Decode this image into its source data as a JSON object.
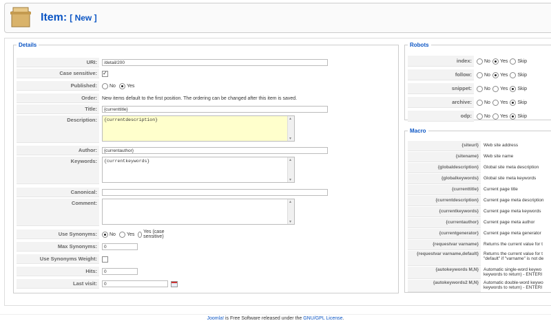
{
  "header": {
    "title": "Item:",
    "subtitle": "[ New ]"
  },
  "details": {
    "legend": "Details",
    "url": {
      "label": "URI:",
      "value": "/detail/200"
    },
    "case_sensitive": {
      "label": "Case sensitive:",
      "checked": true
    },
    "published": {
      "label": "Published:",
      "no": "No",
      "yes": "Yes",
      "selected": "Yes"
    },
    "order": {
      "label": "Order:",
      "text": "New items default to the first position. The ordering can be changed after this item is saved."
    },
    "title": {
      "label": "Title:",
      "value": "{currenttitle}"
    },
    "description": {
      "label": "Description:",
      "value": "{currentdescription}"
    },
    "author": {
      "label": "Author:",
      "value": "{currentauthor}"
    },
    "keywords": {
      "label": "Keywords:",
      "value": "{currentkeywords}"
    },
    "canonical": {
      "label": "Canonical:",
      "value": ""
    },
    "comment": {
      "label": "Comment:",
      "value": ""
    },
    "use_synonyms": {
      "label": "Use Synonyms:",
      "no": "No",
      "yes": "Yes",
      "yes_cs": "Yes (case sensitive)",
      "selected": "No"
    },
    "max_synonyms": {
      "label": "Max Synonyms:",
      "value": "0"
    },
    "use_synonyms_weight": {
      "label": "Use Synonyms Weight:",
      "checked": false
    },
    "hits": {
      "label": "Hits:",
      "value": "0"
    },
    "last_visit": {
      "label": "Last visit:",
      "value": "0"
    }
  },
  "robots": {
    "legend": "Robots",
    "no": "No",
    "yes": "Yes",
    "skip": "Skip",
    "rows": [
      {
        "label": "index:",
        "selected": "Yes"
      },
      {
        "label": "follow:",
        "selected": "Yes"
      },
      {
        "label": "snippet:",
        "selected": "Skip"
      },
      {
        "label": "archive:",
        "selected": "Skip"
      },
      {
        "label": "odp:",
        "selected": "Skip"
      }
    ]
  },
  "macro": {
    "legend": "Macro",
    "rows": [
      {
        "key": "{siteurl}",
        "desc": "Web site address"
      },
      {
        "key": "{sitename}",
        "desc": "Web site name"
      },
      {
        "key": "{globaldescription}",
        "desc": "Global site meta description"
      },
      {
        "key": "{globalkeywords}",
        "desc": "Global site meta keywords"
      },
      {
        "key": "{currenttitle}",
        "desc": "Current page title"
      },
      {
        "key": "{currentdescription}",
        "desc": "Current page meta description"
      },
      {
        "key": "{currentkeywords}",
        "desc": "Current page meta keywords"
      },
      {
        "key": "{currentauthor}",
        "desc": "Current page meta author"
      },
      {
        "key": "{currentgenerator}",
        "desc": "Current page meta generator"
      },
      {
        "key": "{requestvar varname}",
        "desc": "Returns the current value for t"
      },
      {
        "key": "{requestvar varname,default}",
        "desc": "Returns the current value for t \"default\" if \"varname\" is not de"
      },
      {
        "key": "{autokeywords M,N}",
        "desc": "Automatic single-word keywo keywords to return) - ENTERI"
      },
      {
        "key": "{autokeywords2 M,N}",
        "desc": "Automatic double-word keywo keywords to return) - ENTERI"
      }
    ]
  },
  "footer": {
    "joomla": "Joomla!",
    "middle": " is Free Software released under the ",
    "license": "GNU/GPL License",
    "end": "."
  },
  "colors": {
    "accent": "#0b55c4",
    "textarea_highlight": "#ffffcc"
  }
}
